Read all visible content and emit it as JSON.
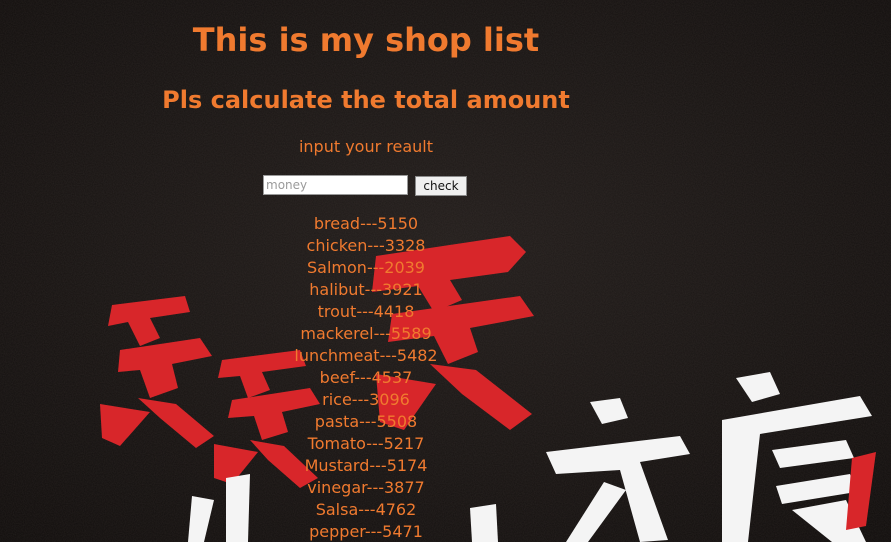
{
  "page": {
    "title": "This is my shop list",
    "subtitle": "Pls calculate the total amount",
    "prompt": "input your reault"
  },
  "form": {
    "input_placeholder": "money",
    "check_label": "check"
  },
  "items": [
    "bread---5150",
    "chicken---3328",
    "Salmon---2039",
    "halibut---3921",
    "trout---4418",
    "mackerel---5589",
    "lunchmeat---5482",
    "beef---4537",
    "rice---3096",
    "pasta---5508",
    "Tomato---5217",
    "Mustard---5174",
    "vinegar---3877",
    "Salsa---4762",
    "pepper---5471"
  ],
  "colors": {
    "text_accent": "#f07a2f",
    "background": "#1a1615",
    "calligraphy_red": "#d8262a",
    "calligraphy_white": "#f4f4f4"
  },
  "background_art": {
    "glyphs": [
      "买",
      "买",
      "买",
      "一",
      "法",
      "太",
      "度",
      "!"
    ]
  }
}
